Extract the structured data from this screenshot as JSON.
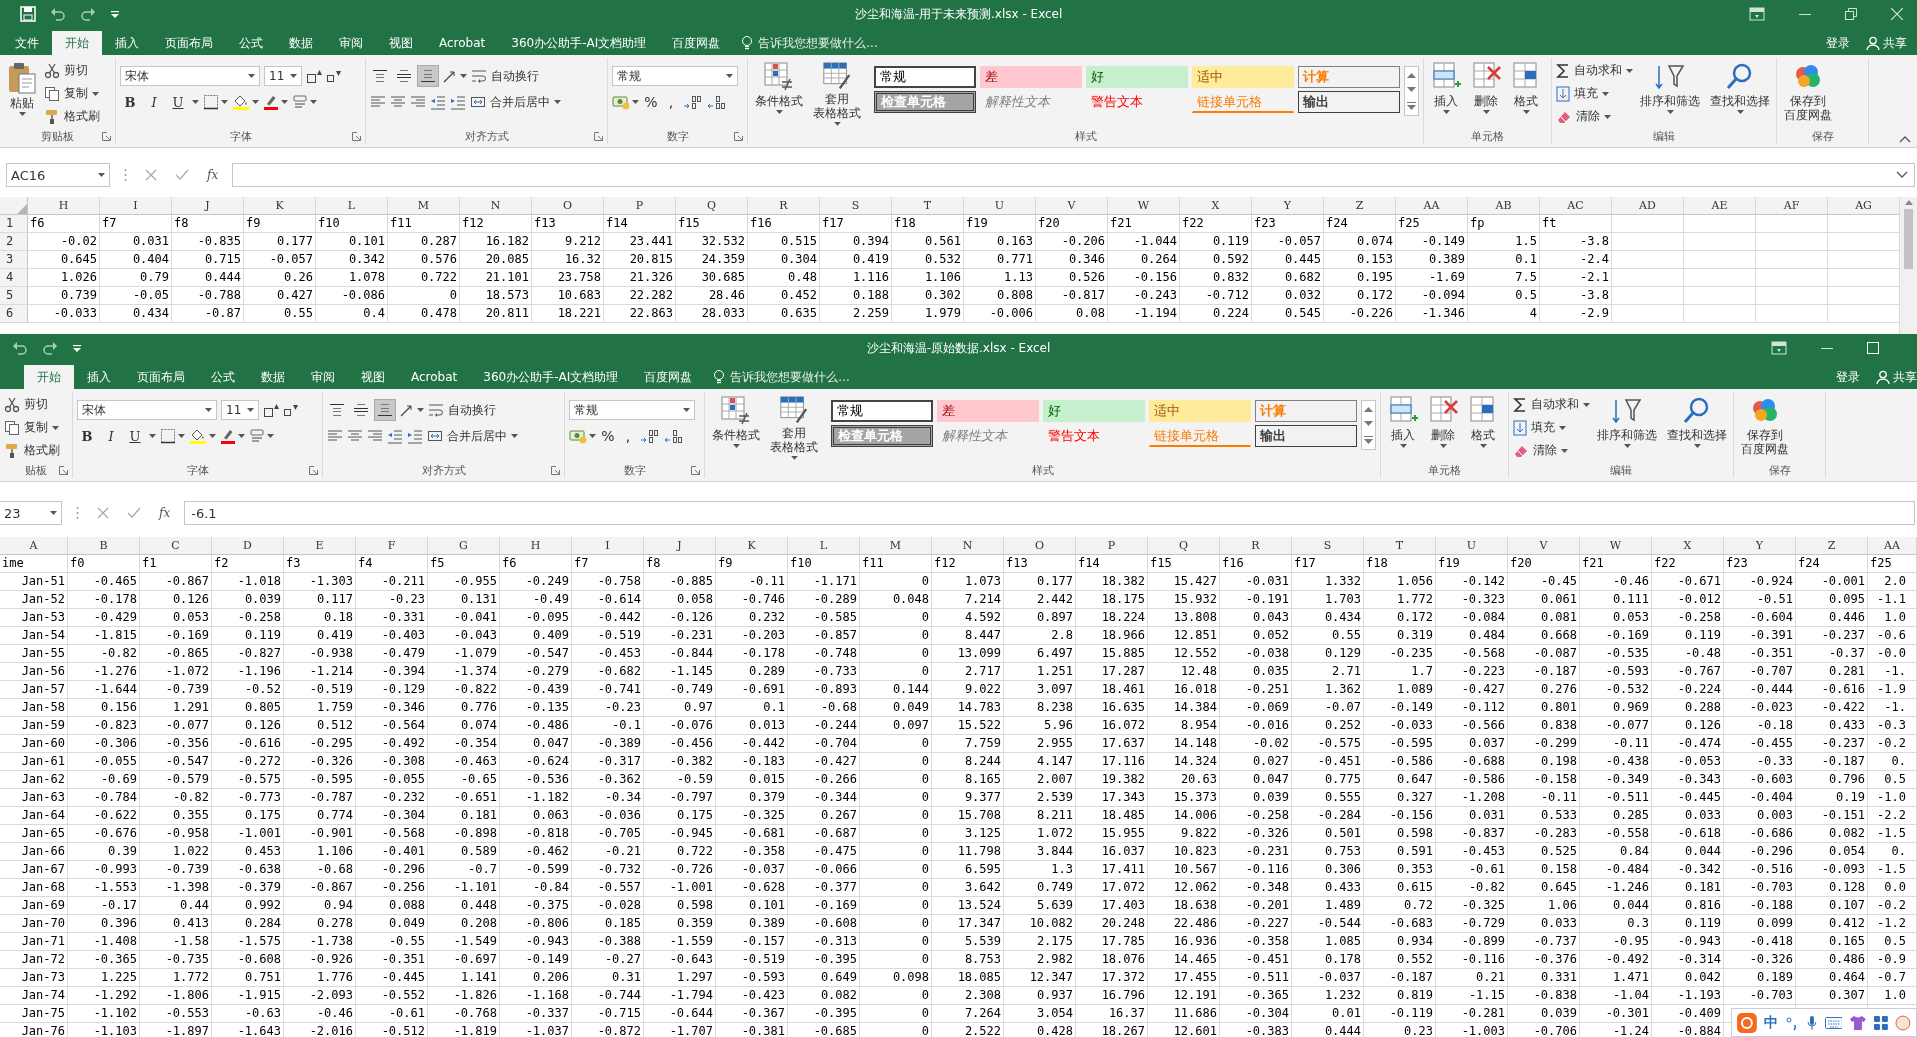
{
  "windows": [
    {
      "title": "沙尘和海温-用于未来预测.xlsx - Excel",
      "cut_left": false,
      "cut_right": false,
      "maximized": true,
      "menu_tabs": [
        {
          "label": "文件",
          "selected": false
        },
        {
          "label": "开始",
          "selected": true
        },
        {
          "label": "插入",
          "selected": false
        },
        {
          "label": "页面布局",
          "selected": false
        },
        {
          "label": "公式",
          "selected": false
        },
        {
          "label": "数据",
          "selected": false
        },
        {
          "label": "审阅",
          "selected": false
        },
        {
          "label": "视图",
          "selected": false
        },
        {
          "label": "Acrobat",
          "selected": false
        },
        {
          "label": "360办公助手-AI文档助理",
          "selected": false
        },
        {
          "label": "百度网盘",
          "selected": false
        }
      ],
      "tell_me": "告诉我您想要做什么...",
      "sign_in": "登录",
      "share": "共享",
      "ribbon": [
        {
          "kind": "clipboard",
          "paste": "粘贴",
          "actions": [
            "剪切",
            "复制",
            "格式刷"
          ],
          "label": "剪贴板"
        },
        {
          "kind": "font",
          "font": "宋体",
          "size": "11",
          "styles": [
            "B",
            "I",
            "U"
          ],
          "label": "字体"
        },
        {
          "kind": "alignment",
          "vertical_align": [
            {
              "selected": false
            },
            {
              "selected": false
            },
            {
              "selected": true
            }
          ],
          "wrap": "自动换行",
          "merge": "合并后居中",
          "label": "对齐方式"
        },
        {
          "kind": "number",
          "format": "常规",
          "symbols": [
            "%",
            ","
          ],
          "label": "数字"
        },
        {
          "kind": "styles",
          "conditional": "条件格式",
          "table": [
            "套用",
            "表格格式"
          ],
          "cells": [
            "常规",
            "差",
            "好",
            "适中",
            "计算",
            "检查单元格",
            "解释性文本",
            "警告文本",
            "链接单元格",
            "输出"
          ],
          "label": "样式"
        },
        {
          "kind": "cells",
          "buttons": [
            "插入",
            "删除",
            "格式"
          ],
          "label": "单元格"
        },
        {
          "kind": "editing",
          "actions": [
            "自动求和",
            "填充",
            "清除"
          ],
          "buttons": [
            "排序和筛选",
            "查找和选择"
          ],
          "label": "编辑"
        },
        {
          "kind": "save",
          "lines": [
            "保存到",
            "百度网盘"
          ],
          "label": "保存"
        }
      ],
      "name_box": "AC16",
      "function_label": "fx",
      "columns": [
        "H",
        "I",
        "J",
        "K",
        "L",
        "M",
        "N",
        "O",
        "P",
        "Q",
        "R",
        "S",
        "T",
        "U",
        "V",
        "W",
        "X",
        "Y",
        "Z",
        "AA",
        "AB",
        "AC",
        "AD",
        "AE",
        "AF",
        "AG"
      ],
      "rows": [
        {
          "number": "1",
          "kind": "header",
          "cells": [
            "f6",
            "f7",
            "f8",
            "f9",
            "f10",
            "f11",
            "f12",
            "f13",
            "f14",
            "f15",
            "f16",
            "f17",
            "f18",
            "f19",
            "f20",
            "f21",
            "f22",
            "f23",
            "f24",
            "f25",
            "fp",
            "ft"
          ]
        },
        {
          "number": "2",
          "kind": "data",
          "cells": [
            "-0.02",
            "0.031",
            "-0.835",
            "0.177",
            "0.101",
            "0.287",
            "16.182",
            "9.212",
            "23.441",
            "32.532",
            "0.515",
            "0.394",
            "0.561",
            "0.163",
            "-0.206",
            "-1.044",
            "0.119",
            "-0.057",
            "0.074",
            "-0.149",
            "1.5",
            "-3.8"
          ]
        },
        {
          "number": "3",
          "kind": "data",
          "cells": [
            "0.645",
            "0.404",
            "0.715",
            "-0.057",
            "0.342",
            "0.576",
            "20.085",
            "16.32",
            "20.815",
            "24.359",
            "0.304",
            "0.419",
            "0.532",
            "0.771",
            "0.346",
            "0.264",
            "0.592",
            "0.445",
            "0.153",
            "0.389",
            "0.1",
            "-2.4"
          ]
        },
        {
          "number": "4",
          "kind": "data",
          "cells": [
            "1.026",
            "0.79",
            "0.444",
            "0.26",
            "1.078",
            "0.722",
            "21.101",
            "23.758",
            "21.326",
            "30.685",
            "0.48",
            "1.116",
            "1.106",
            "1.13",
            "0.526",
            "-0.156",
            "0.832",
            "0.682",
            "0.195",
            "-1.69",
            "7.5",
            "-2.1"
          ]
        },
        {
          "number": "5",
          "kind": "data",
          "cells": [
            "0.739",
            "-0.05",
            "-0.788",
            "0.427",
            "-0.086",
            "0",
            "18.573",
            "10.683",
            "22.282",
            "28.46",
            "0.452",
            "0.188",
            "0.302",
            "0.808",
            "-0.817",
            "-0.243",
            "-0.712",
            "0.032",
            "0.172",
            "-0.094",
            "0.5",
            "-3.8"
          ]
        },
        {
          "number": "6",
          "kind": "data",
          "cells": [
            "-0.033",
            "0.434",
            "-0.87",
            "0.55",
            "0.4",
            "0.478",
            "20.811",
            "18.221",
            "22.863",
            "28.033",
            "0.635",
            "2.259",
            "1.979",
            "-0.006",
            "0.08",
            "-1.194",
            "0.224",
            "0.545",
            "-0.226",
            "-1.346",
            "4",
            "-2.9"
          ]
        }
      ]
    },
    {
      "title": "沙尘和海温-原始数据.xlsx - Excel",
      "cut_left": true,
      "cut_right": true,
      "maximized": false,
      "menu_tabs": [
        {
          "label": "开始",
          "selected": true
        },
        {
          "label": "插入",
          "selected": false
        },
        {
          "label": "页面布局",
          "selected": false
        },
        {
          "label": "公式",
          "selected": false
        },
        {
          "label": "数据",
          "selected": false
        },
        {
          "label": "审阅",
          "selected": false
        },
        {
          "label": "视图",
          "selected": false
        },
        {
          "label": "Acrobat",
          "selected": false
        },
        {
          "label": "360办公助手-AI文档助理",
          "selected": false
        },
        {
          "label": "百度网盘",
          "selected": false
        }
      ],
      "tell_me": "告诉我您想要做什么...",
      "sign_in": "登录",
      "share": "共享",
      "ribbon": [
        {
          "kind": "clipboard",
          "actions": [
            "剪切",
            "复制",
            "格式刷"
          ],
          "label": "贴板"
        },
        {
          "kind": "font",
          "font": "宋体",
          "size": "11",
          "styles": [
            "B",
            "I",
            "U"
          ],
          "label": "字体"
        },
        {
          "kind": "alignment",
          "vertical_align": [
            {
              "selected": false
            },
            {
              "selected": false
            },
            {
              "selected": true
            }
          ],
          "wrap": "自动换行",
          "merge": "合并后居中",
          "label": "对齐方式"
        },
        {
          "kind": "number",
          "format": "常规",
          "symbols": [
            "%",
            ","
          ],
          "label": "数字"
        },
        {
          "kind": "styles",
          "conditional": "条件格式",
          "table": [
            "套用",
            "表格格式"
          ],
          "cells": [
            "常规",
            "差",
            "好",
            "适中",
            "计算",
            "检查单元格",
            "解释性文本",
            "警告文本",
            "链接单元格",
            "输出"
          ],
          "label": "样式"
        },
        {
          "kind": "cells",
          "buttons": [
            "插入",
            "删除",
            "格式"
          ],
          "label": "单元格"
        },
        {
          "kind": "editing",
          "actions": [
            "自动求和",
            "填充",
            "清除"
          ],
          "buttons": [
            "排序和筛选",
            "查找和选择"
          ],
          "label": "编辑"
        },
        {
          "kind": "save",
          "lines": [
            "保存到",
            "百度网盘"
          ],
          "label": "保存"
        }
      ],
      "name_box": "23",
      "function_label": "fx",
      "formula": "-6.1",
      "columns": [
        "A",
        "B",
        "C",
        "D",
        "E",
        "F",
        "G",
        "H",
        "I",
        "J",
        "K",
        "L",
        "M",
        "N",
        "O",
        "P",
        "Q",
        "R",
        "S",
        "T",
        "U",
        "V",
        "W",
        "X",
        "Y",
        "Z",
        "AA"
      ],
      "rows": [
        {
          "kind": "header",
          "cells": [
            "ime",
            "f0",
            "f1",
            "f2",
            "f3",
            "f4",
            "f5",
            "f6",
            "f7",
            "f8",
            "f9",
            "f10",
            "f11",
            "f12",
            "f13",
            "f14",
            "f15",
            "f16",
            "f17",
            "f18",
            "f19",
            "f20",
            "f21",
            "f22",
            "f23",
            "f24",
            "f25"
          ]
        },
        {
          "kind": "data",
          "cells": [
            "Jan-51",
            "-0.465",
            "-0.867",
            "-1.018",
            "-1.303",
            "-0.211",
            "-0.955",
            "-0.249",
            "-0.758",
            "-0.885",
            "-0.11",
            "-1.171",
            "0",
            "1.073",
            "0.177",
            "18.382",
            "15.427",
            "-0.031",
            "1.332",
            "1.056",
            "-0.142",
            "-0.45",
            "-0.46",
            "-0.671",
            "-0.924",
            "-0.001",
            "2.0"
          ]
        },
        {
          "kind": "data",
          "cells": [
            "Jan-52",
            "-0.178",
            "0.126",
            "0.039",
            "0.117",
            "-0.23",
            "0.131",
            "-0.49",
            "-0.614",
            "0.058",
            "-0.746",
            "-0.289",
            "0.048",
            "7.214",
            "2.442",
            "18.175",
            "15.932",
            "-0.191",
            "1.703",
            "1.772",
            "-0.323",
            "0.061",
            "0.111",
            "-0.012",
            "-0.51",
            "0.095",
            "-1.1"
          ]
        },
        {
          "kind": "data",
          "cells": [
            "Jan-53",
            "-0.429",
            "0.053",
            "-0.258",
            "0.18",
            "-0.331",
            "-0.041",
            "-0.095",
            "-0.442",
            "-0.126",
            "0.232",
            "-0.585",
            "0",
            "4.592",
            "0.897",
            "18.224",
            "13.808",
            "0.043",
            "0.434",
            "0.172",
            "-0.084",
            "0.081",
            "0.053",
            "-0.258",
            "-0.604",
            "0.446",
            "1.0"
          ]
        },
        {
          "kind": "data",
          "cells": [
            "Jan-54",
            "-1.815",
            "-0.169",
            "0.119",
            "0.419",
            "-0.403",
            "-0.043",
            "0.409",
            "-0.519",
            "-0.231",
            "-0.203",
            "-0.857",
            "0",
            "8.447",
            "2.8",
            "18.966",
            "12.851",
            "0.052",
            "0.55",
            "0.319",
            "0.484",
            "0.668",
            "-0.169",
            "0.119",
            "-0.391",
            "-0.237",
            "-0.6"
          ]
        },
        {
          "kind": "data",
          "cells": [
            "Jan-55",
            "-0.82",
            "-0.865",
            "-0.827",
            "-0.938",
            "-0.479",
            "-1.079",
            "-0.547",
            "-0.453",
            "-0.844",
            "-0.178",
            "-0.748",
            "0",
            "13.099",
            "6.497",
            "15.885",
            "12.552",
            "-0.038",
            "0.129",
            "-0.235",
            "-0.568",
            "-0.087",
            "-0.535",
            "-0.48",
            "-0.351",
            "-0.37",
            "-0.0"
          ]
        },
        {
          "kind": "data",
          "cells": [
            "Jan-56",
            "-1.276",
            "-1.072",
            "-1.196",
            "-1.214",
            "-0.394",
            "-1.374",
            "-0.279",
            "-0.682",
            "-1.145",
            "0.289",
            "-0.733",
            "0",
            "2.717",
            "1.251",
            "17.287",
            "12.48",
            "0.035",
            "2.71",
            "1.7",
            "-0.223",
            "-0.187",
            "-0.593",
            "-0.767",
            "-0.707",
            "0.281",
            "-1."
          ]
        },
        {
          "kind": "data",
          "cells": [
            "Jan-57",
            "-1.644",
            "-0.739",
            "-0.52",
            "-0.519",
            "-0.129",
            "-0.822",
            "-0.439",
            "-0.741",
            "-0.749",
            "-0.691",
            "-0.893",
            "0.144",
            "9.022",
            "3.097",
            "18.461",
            "16.018",
            "-0.251",
            "1.362",
            "1.089",
            "-0.427",
            "0.276",
            "-0.532",
            "-0.224",
            "-0.444",
            "-0.616",
            "-1.9"
          ]
        },
        {
          "kind": "data",
          "cells": [
            "Jan-58",
            "0.156",
            "1.291",
            "0.805",
            "1.759",
            "-0.346",
            "0.776",
            "-0.135",
            "-0.23",
            "0.97",
            "0.1",
            "-0.68",
            "0.049",
            "14.783",
            "8.238",
            "16.635",
            "14.384",
            "-0.069",
            "-0.07",
            "-0.149",
            "-0.112",
            "0.801",
            "0.969",
            "0.288",
            "-0.023",
            "-0.422",
            "-1."
          ]
        },
        {
          "kind": "data",
          "cells": [
            "Jan-59",
            "-0.823",
            "-0.077",
            "0.126",
            "0.512",
            "-0.564",
            "0.074",
            "-0.486",
            "-0.1",
            "-0.076",
            "0.013",
            "-0.244",
            "0.097",
            "15.522",
            "5.96",
            "16.072",
            "8.954",
            "-0.016",
            "0.252",
            "-0.033",
            "-0.566",
            "0.838",
            "-0.077",
            "0.126",
            "-0.18",
            "0.433",
            "-0.3"
          ]
        },
        {
          "kind": "data",
          "cells": [
            "Jan-60",
            "-0.306",
            "-0.356",
            "-0.616",
            "-0.295",
            "-0.492",
            "-0.354",
            "0.047",
            "-0.389",
            "-0.456",
            "-0.442",
            "-0.704",
            "0",
            "7.759",
            "2.955",
            "17.637",
            "14.148",
            "-0.02",
            "-0.575",
            "-0.595",
            "0.037",
            "-0.299",
            "-0.11",
            "-0.474",
            "-0.455",
            "-0.237",
            "-0.2"
          ]
        },
        {
          "kind": "data",
          "cells": [
            "Jan-61",
            "-0.055",
            "-0.547",
            "-0.272",
            "-0.326",
            "-0.308",
            "-0.463",
            "-0.624",
            "-0.317",
            "-0.382",
            "-0.183",
            "-0.427",
            "0",
            "8.244",
            "4.147",
            "17.116",
            "14.324",
            "0.027",
            "-0.451",
            "-0.586",
            "-0.688",
            "0.198",
            "-0.438",
            "-0.053",
            "-0.33",
            "-0.187",
            "0."
          ]
        },
        {
          "kind": "data",
          "cells": [
            "Jan-62",
            "-0.69",
            "-0.579",
            "-0.575",
            "-0.595",
            "-0.055",
            "-0.65",
            "-0.536",
            "-0.362",
            "-0.59",
            "0.015",
            "-0.266",
            "0",
            "8.165",
            "2.007",
            "19.382",
            "20.63",
            "0.047",
            "0.775",
            "0.647",
            "-0.586",
            "-0.158",
            "-0.349",
            "-0.343",
            "-0.603",
            "0.796",
            "0.5"
          ]
        },
        {
          "kind": "data",
          "cells": [
            "Jan-63",
            "-0.784",
            "-0.82",
            "-0.773",
            "-0.787",
            "-0.232",
            "-0.651",
            "-1.182",
            "-0.34",
            "-0.797",
            "0.379",
            "-0.344",
            "0",
            "9.377",
            "2.539",
            "17.343",
            "15.373",
            "0.039",
            "0.555",
            "0.327",
            "-1.208",
            "-0.11",
            "-0.511",
            "-0.445",
            "-0.404",
            "0.19",
            "-1.0"
          ]
        },
        {
          "kind": "data",
          "cells": [
            "Jan-64",
            "-0.622",
            "0.355",
            "0.175",
            "0.774",
            "-0.304",
            "0.181",
            "0.063",
            "-0.036",
            "0.175",
            "-0.325",
            "0.267",
            "0",
            "15.708",
            "8.211",
            "18.485",
            "14.006",
            "-0.258",
            "-0.284",
            "-0.156",
            "0.031",
            "0.533",
            "0.285",
            "0.033",
            "0.003",
            "-0.151",
            "-2.2"
          ]
        },
        {
          "kind": "data",
          "cells": [
            "Jan-65",
            "-0.676",
            "-0.958",
            "-1.001",
            "-0.901",
            "-0.568",
            "-0.898",
            "-0.818",
            "-0.705",
            "-0.945",
            "-0.681",
            "-0.687",
            "0",
            "3.125",
            "1.072",
            "15.955",
            "9.822",
            "-0.326",
            "0.501",
            "0.598",
            "-0.837",
            "-0.283",
            "-0.558",
            "-0.618",
            "-0.686",
            "0.082",
            "-1.5"
          ]
        },
        {
          "kind": "data",
          "cells": [
            "Jan-66",
            "0.39",
            "1.022",
            "0.453",
            "1.106",
            "-0.401",
            "0.589",
            "-0.462",
            "-0.21",
            "0.722",
            "-0.358",
            "-0.475",
            "0",
            "11.798",
            "3.844",
            "16.037",
            "10.823",
            "-0.231",
            "0.753",
            "0.591",
            "-0.453",
            "0.525",
            "0.84",
            "0.044",
            "-0.296",
            "0.054",
            "0."
          ]
        },
        {
          "kind": "data",
          "cells": [
            "Jan-67",
            "-0.993",
            "-0.739",
            "-0.638",
            "-0.68",
            "-0.296",
            "-0.7",
            "-0.599",
            "-0.732",
            "-0.726",
            "-0.037",
            "-0.066",
            "0",
            "6.595",
            "1.3",
            "17.411",
            "10.567",
            "-0.116",
            "0.306",
            "0.353",
            "-0.61",
            "0.158",
            "-0.484",
            "-0.342",
            "-0.516",
            "-0.093",
            "-1.5"
          ]
        },
        {
          "kind": "data",
          "cells": [
            "Jan-68",
            "-1.553",
            "-1.398",
            "-0.379",
            "-0.867",
            "-0.256",
            "-1.101",
            "-0.84",
            "-0.557",
            "-1.001",
            "-0.628",
            "-0.377",
            "0",
            "3.642",
            "0.749",
            "17.072",
            "12.062",
            "-0.348",
            "0.433",
            "0.615",
            "-0.82",
            "0.645",
            "-1.246",
            "0.181",
            "-0.703",
            "0.128",
            "0.0"
          ]
        },
        {
          "kind": "data",
          "cells": [
            "Jan-69",
            "-0.17",
            "0.44",
            "0.992",
            "0.94",
            "0.088",
            "0.448",
            "-0.375",
            "-0.028",
            "0.598",
            "0.101",
            "-0.169",
            "0",
            "13.524",
            "5.639",
            "17.403",
            "18.638",
            "-0.201",
            "1.489",
            "0.72",
            "-0.325",
            "1.06",
            "0.044",
            "0.816",
            "-0.188",
            "0.107",
            "-0.2"
          ]
        },
        {
          "kind": "data",
          "cells": [
            "Jan-70",
            "0.396",
            "0.413",
            "0.284",
            "0.278",
            "0.049",
            "0.208",
            "-0.806",
            "0.185",
            "0.359",
            "0.389",
            "-0.608",
            "0",
            "17.347",
            "10.082",
            "20.248",
            "22.486",
            "-0.227",
            "-0.544",
            "-0.683",
            "-0.729",
            "0.033",
            "0.3",
            "0.119",
            "0.099",
            "0.412",
            "-1.2"
          ]
        },
        {
          "kind": "data",
          "cells": [
            "Jan-71",
            "-1.408",
            "-1.58",
            "-1.575",
            "-1.738",
            "-0.55",
            "-1.549",
            "-0.943",
            "-0.388",
            "-1.559",
            "-0.157",
            "-0.313",
            "0",
            "5.539",
            "2.175",
            "17.785",
            "16.936",
            "-0.358",
            "1.085",
            "0.934",
            "-0.899",
            "-0.737",
            "-0.95",
            "-0.943",
            "-0.418",
            "0.165",
            "0.5"
          ]
        },
        {
          "kind": "data",
          "cells": [
            "Jan-72",
            "-0.365",
            "-0.735",
            "-0.608",
            "-0.926",
            "-0.351",
            "-0.697",
            "-0.149",
            "-0.27",
            "-0.643",
            "-0.519",
            "-0.395",
            "0",
            "8.753",
            "2.982",
            "18.076",
            "14.465",
            "-0.451",
            "0.178",
            "0.552",
            "-0.116",
            "-0.376",
            "-0.492",
            "-0.314",
            "-0.326",
            "0.486",
            "-0.9"
          ]
        },
        {
          "kind": "data",
          "cells": [
            "Jan-73",
            "1.225",
            "1.772",
            "0.751",
            "1.776",
            "-0.445",
            "1.141",
            "0.206",
            "0.31",
            "1.297",
            "-0.593",
            "0.649",
            "0.098",
            "18.085",
            "12.347",
            "17.372",
            "17.455",
            "-0.511",
            "-0.037",
            "-0.187",
            "0.21",
            "0.331",
            "1.471",
            "0.042",
            "0.189",
            "0.464",
            "-0.7"
          ]
        },
        {
          "kind": "data",
          "cells": [
            "Jan-74",
            "-1.292",
            "-1.806",
            "-1.915",
            "-2.093",
            "-0.552",
            "-1.826",
            "-1.168",
            "-0.744",
            "-1.794",
            "-0.423",
            "0.082",
            "0",
            "2.308",
            "0.937",
            "16.796",
            "12.191",
            "-0.365",
            "1.232",
            "0.819",
            "-1.15",
            "-0.838",
            "-1.04",
            "-1.193",
            "-0.703",
            "0.307",
            "1.0"
          ]
        },
        {
          "kind": "data",
          "cells": [
            "Jan-75",
            "-1.102",
            "-0.553",
            "-0.63",
            "-0.46",
            "-0.61",
            "-0.768",
            "-0.337",
            "-0.715",
            "-0.644",
            "-0.367",
            "-0.395",
            "0",
            "7.264",
            "3.054",
            "16.37",
            "11.686",
            "-0.304",
            "0.01",
            "-0.119",
            "-0.281",
            "0.039",
            "-0.301",
            "-0.409"
          ]
        },
        {
          "kind": "data",
          "cells": [
            "Jan-76",
            "-1.103",
            "-1.897",
            "-1.643",
            "-2.016",
            "-0.512",
            "-1.819",
            "-1.037",
            "-0.872",
            "-1.707",
            "-0.381",
            "-0.685",
            "0",
            "2.522",
            "0.428",
            "18.267",
            "12.601",
            "-0.383",
            "0.444",
            "0.23",
            "-1.003",
            "-0.706",
            "-1.24",
            "-0.884"
          ]
        }
      ]
    }
  ],
  "ime_toolbar": {
    "mode": "中"
  }
}
